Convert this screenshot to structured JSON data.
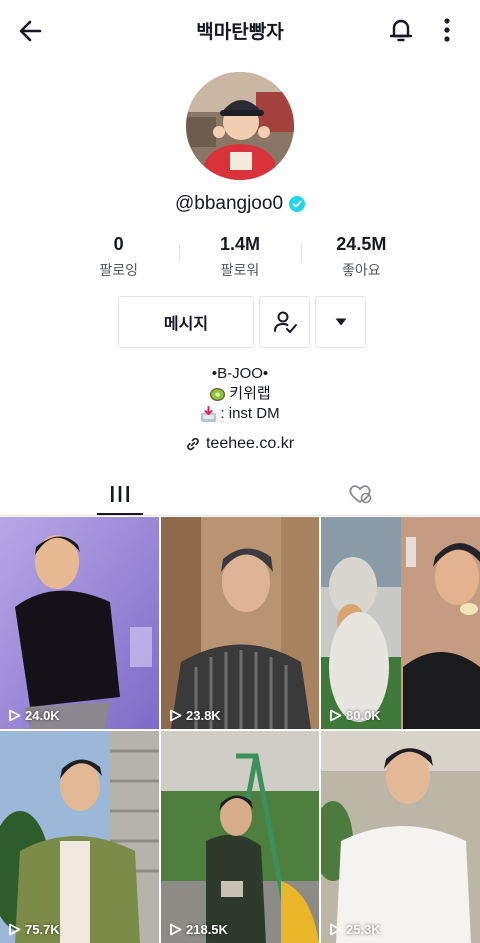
{
  "header": {
    "title": "백마탄빵자",
    "icons": {
      "back": "back-arrow-icon",
      "notification": "bell-icon",
      "more": "vertical-dots-icon"
    }
  },
  "profile": {
    "handle": "@bbangjoo0",
    "verified": true,
    "verified_color": "#20d5ec"
  },
  "stats": [
    {
      "value": "0",
      "label": "팔로잉"
    },
    {
      "value": "1.4M",
      "label": "팔로워"
    },
    {
      "value": "24.5M",
      "label": "좋아요"
    }
  ],
  "actions": {
    "message_label": "메시지",
    "follow_icon": "person-check-icon",
    "more_icon": "caret-down-icon"
  },
  "bio": {
    "line1": "•B-JOO•",
    "line2": "키위랩",
    "line2_emoji": "kiwi-emoji",
    "line3": ": inst DM",
    "line3_emoji": "inbox-tray-emoji"
  },
  "link": {
    "text": "teehee.co.kr",
    "icon": "link-icon"
  },
  "tabs": [
    {
      "name": "videos",
      "icon": "grid-bars-icon",
      "active": true
    },
    {
      "name": "liked",
      "icon": "heart-hidden-icon",
      "active": false
    }
  ],
  "videos": [
    {
      "views": "24.0K"
    },
    {
      "views": "23.8K"
    },
    {
      "views": "80.0K"
    },
    {
      "views": "75.7K"
    },
    {
      "views": "218.5K"
    },
    {
      "views": "25.3K"
    }
  ],
  "colors": {
    "text": "#161823",
    "secondary_text": "#55575f",
    "border": "#e3e3e4"
  }
}
